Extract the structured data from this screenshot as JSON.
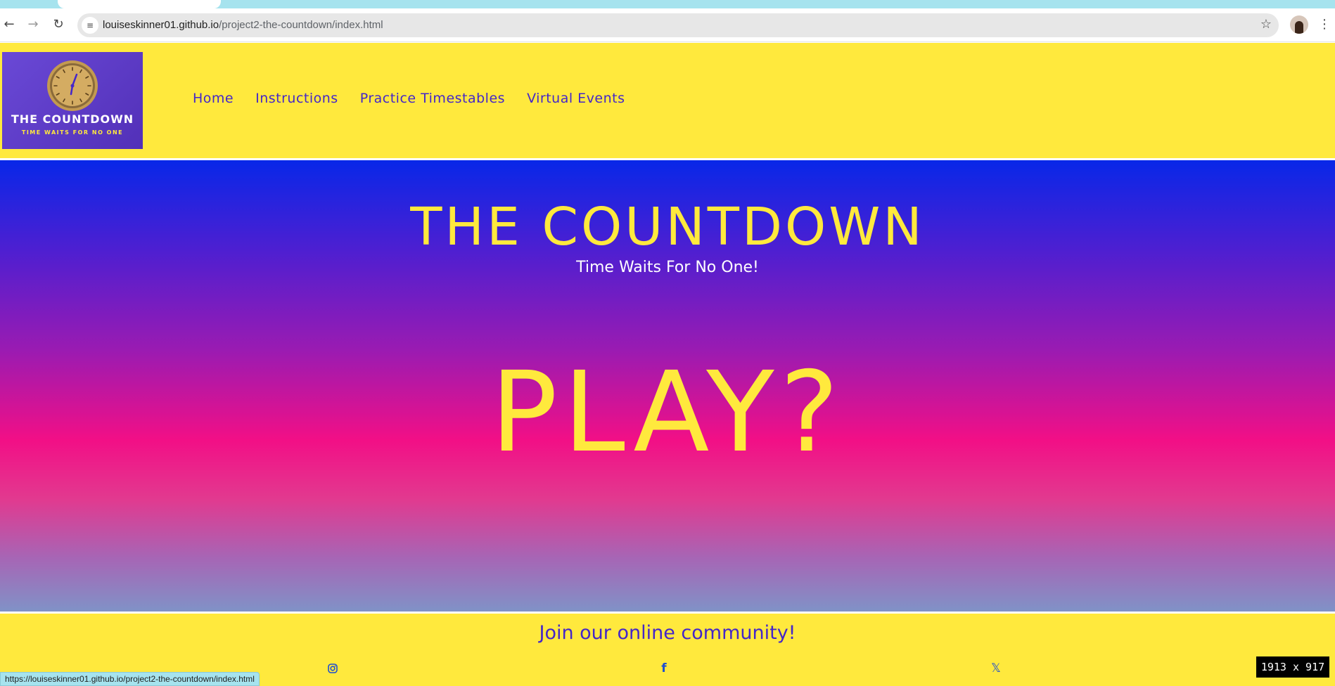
{
  "browser": {
    "url_host": "louiseskinner01.github.io",
    "url_path": "/project2-the-countdown/index.html",
    "back_icon": "←",
    "forward_icon": "→",
    "reload_icon": "↻",
    "site_info_icon": "≡",
    "bookmark_icon": "☆",
    "menu_icon": "⋮",
    "status_url": "https://louiseskinner01.github.io/project2-the-countdown/index.html",
    "tab_strip_color": "#a6e3ee"
  },
  "header": {
    "logo_title": "THE COUNTDOWN",
    "logo_subtitle": "TIME WAITS FOR NO ONE",
    "nav": [
      "Home",
      "Instructions",
      "Practice Timestables",
      "Virtual Events"
    ],
    "background": "#ffe93d",
    "nav_color": "#4426c9"
  },
  "hero": {
    "title": "THE COUNTDOWN",
    "subtitle": "Time Waits For No One!",
    "play_label": "PLAY?",
    "title_color": "#ffe93d"
  },
  "footer": {
    "heading": "Join our online community!",
    "social": [
      {
        "name": "instagram-icon",
        "glyph": "◎"
      },
      {
        "name": "facebook-icon",
        "glyph": "f"
      },
      {
        "name": "x-icon",
        "glyph": "𝕏"
      }
    ]
  },
  "overlay": {
    "dimensions": "1913 x 917"
  }
}
